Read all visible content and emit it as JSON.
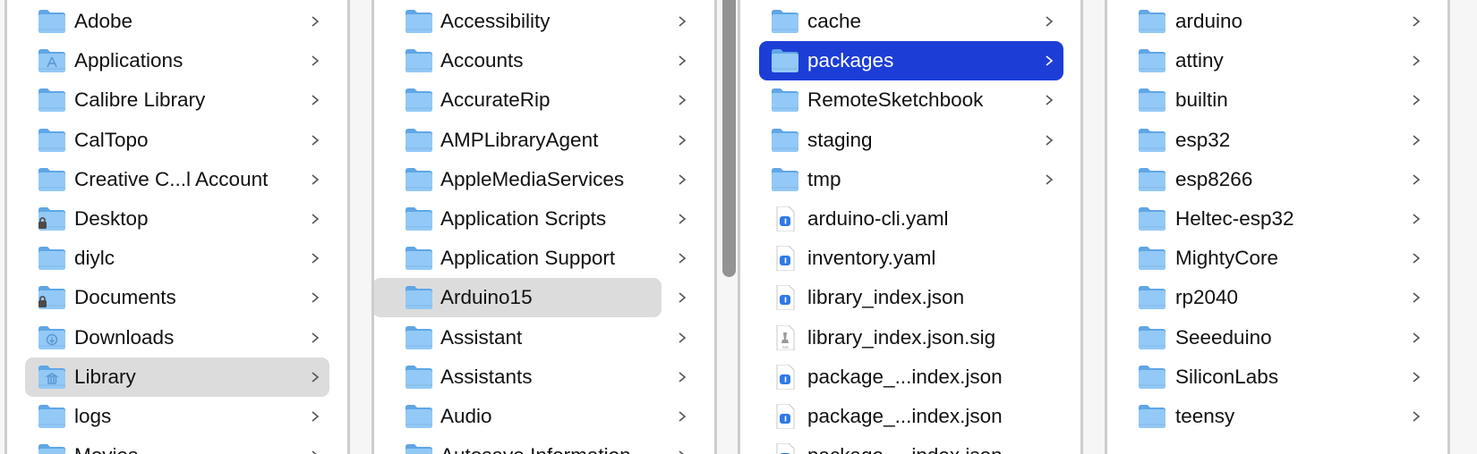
{
  "columns": [
    {
      "name": "home",
      "items": [
        {
          "label": "Adobe",
          "icon": "folder",
          "chevron": true
        },
        {
          "label": "Applications",
          "icon": "folder-applications",
          "chevron": true
        },
        {
          "label": "Calibre Library",
          "icon": "folder",
          "chevron": true
        },
        {
          "label": "CalTopo",
          "icon": "folder",
          "chevron": true
        },
        {
          "label": "Creative C...l Account",
          "icon": "folder",
          "chevron": true
        },
        {
          "label": "Desktop",
          "icon": "folder-locked",
          "chevron": true
        },
        {
          "label": "diylc",
          "icon": "folder",
          "chevron": true
        },
        {
          "label": "Documents",
          "icon": "folder-locked",
          "chevron": true
        },
        {
          "label": "Downloads",
          "icon": "folder-downloads",
          "chevron": true
        },
        {
          "label": "Library",
          "icon": "folder-library",
          "chevron": true,
          "selected": "gray"
        },
        {
          "label": "logs",
          "icon": "folder",
          "chevron": true
        },
        {
          "label": "Movies",
          "icon": "folder",
          "chevron": true
        }
      ]
    },
    {
      "name": "library",
      "items": [
        {
          "label": "Accessibility",
          "icon": "folder",
          "chevron": true
        },
        {
          "label": "Accounts",
          "icon": "folder",
          "chevron": true
        },
        {
          "label": "AccurateRip",
          "icon": "folder",
          "chevron": true
        },
        {
          "label": "AMPLibraryAgent",
          "icon": "folder",
          "chevron": true
        },
        {
          "label": "AppleMediaServices",
          "icon": "folder",
          "chevron": true
        },
        {
          "label": "Application Scripts",
          "icon": "folder",
          "chevron": true
        },
        {
          "label": "Application Support",
          "icon": "folder",
          "chevron": true
        },
        {
          "label": "Arduino15",
          "icon": "folder",
          "chevron": true,
          "selected": "gray"
        },
        {
          "label": "Assistant",
          "icon": "folder",
          "chevron": true
        },
        {
          "label": "Assistants",
          "icon": "folder",
          "chevron": true
        },
        {
          "label": "Audio",
          "icon": "folder",
          "chevron": true
        },
        {
          "label": "Autosave Information",
          "icon": "folder",
          "chevron": true
        }
      ]
    },
    {
      "name": "arduino15",
      "items": [
        {
          "label": "cache",
          "icon": "folder",
          "chevron": true
        },
        {
          "label": "packages",
          "icon": "folder",
          "chevron": true,
          "selected": "blue"
        },
        {
          "label": "RemoteSketchbook",
          "icon": "folder",
          "chevron": true
        },
        {
          "label": "staging",
          "icon": "folder",
          "chevron": true
        },
        {
          "label": "tmp",
          "icon": "folder",
          "chevron": true
        },
        {
          "label": "arduino-cli.yaml",
          "icon": "file-info",
          "chevron": false
        },
        {
          "label": "inventory.yaml",
          "icon": "file-info",
          "chevron": false
        },
        {
          "label": "library_index.json",
          "icon": "file-info",
          "chevron": false
        },
        {
          "label": "library_index.json.sig",
          "icon": "file-signature",
          "chevron": false
        },
        {
          "label": "package_...index.json",
          "icon": "file-info",
          "chevron": false
        },
        {
          "label": "package_...index.json",
          "icon": "file-info",
          "chevron": false
        },
        {
          "label": "package_...index.json",
          "icon": "file-info",
          "chevron": false
        }
      ]
    },
    {
      "name": "packages",
      "items": [
        {
          "label": "arduino",
          "icon": "folder",
          "chevron": true
        },
        {
          "label": "attiny",
          "icon": "folder",
          "chevron": true
        },
        {
          "label": "builtin",
          "icon": "folder",
          "chevron": true
        },
        {
          "label": "esp32",
          "icon": "folder",
          "chevron": true
        },
        {
          "label": "esp8266",
          "icon": "folder",
          "chevron": true
        },
        {
          "label": "Heltec-esp32",
          "icon": "folder",
          "chevron": true
        },
        {
          "label": "MightyCore",
          "icon": "folder",
          "chevron": true
        },
        {
          "label": "rp2040",
          "icon": "folder",
          "chevron": true
        },
        {
          "label": "Seeeduino",
          "icon": "folder",
          "chevron": true
        },
        {
          "label": "SiliconLabs",
          "icon": "folder",
          "chevron": true
        },
        {
          "label": "teensy",
          "icon": "folder",
          "chevron": true
        }
      ]
    }
  ],
  "colors": {
    "selection_blue": "#1c3ed6",
    "selection_gray": "#dcdcdc",
    "folder": "#8cc4f4"
  }
}
